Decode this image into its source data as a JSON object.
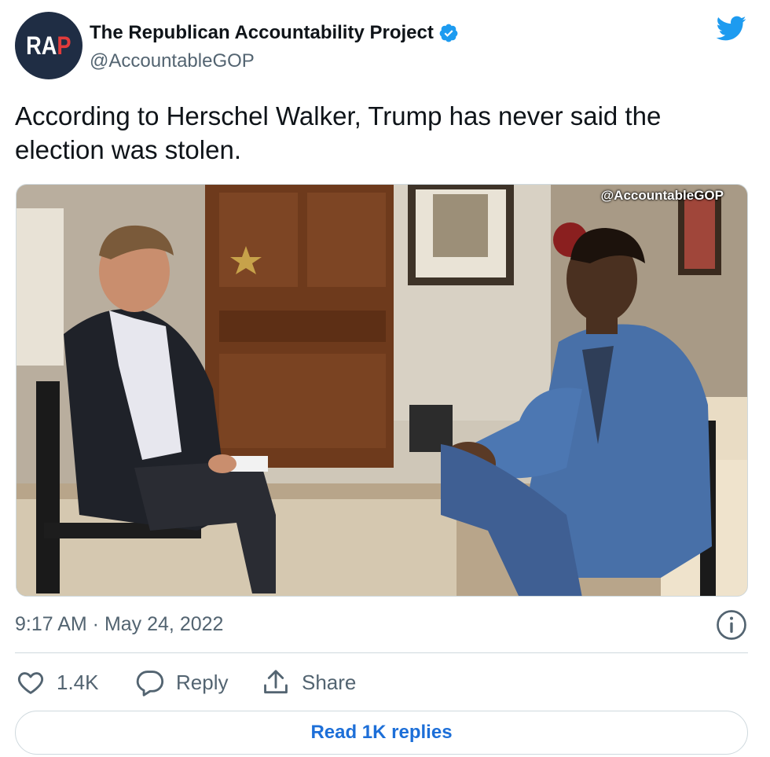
{
  "author": {
    "avatar_text_a": "RA",
    "avatar_text_b": "P",
    "display_name": "The Republican Accountability Project",
    "handle": "@AccountableGOP",
    "verified": true
  },
  "tweet": {
    "text": "According to Herschel Walker, Trump has never said the election was stolen.",
    "media_watermark": "@AccountableGOP",
    "timestamp": "9:17 AM · May 24, 2022"
  },
  "actions": {
    "like_count": "1.4K",
    "reply_label": "Reply",
    "share_label": "Share"
  },
  "footer": {
    "read_replies_label": "Read 1K replies"
  },
  "icons": {
    "brand": "twitter-bird-icon",
    "verified": "verified-badge-icon",
    "info": "info-icon",
    "like": "heart-icon",
    "reply": "speech-bubble-icon",
    "share": "share-icon"
  },
  "colors": {
    "twitter_blue": "#1d9bf0",
    "link_blue": "#1d6fd8",
    "muted_text": "#536471",
    "avatar_bg": "#1f2d44",
    "avatar_accent": "#e23b3b"
  }
}
